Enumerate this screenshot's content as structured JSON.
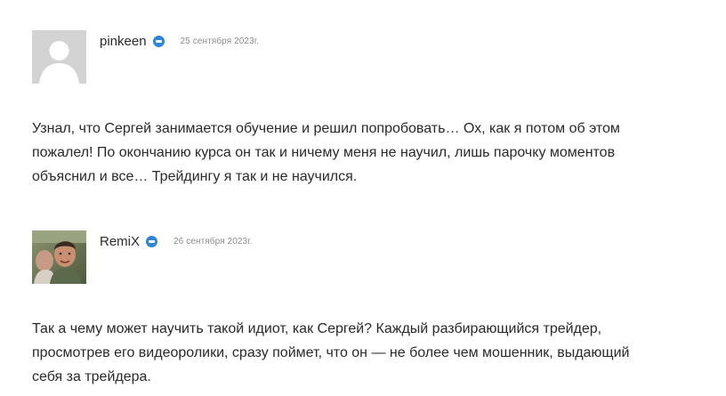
{
  "comments": [
    {
      "author": "pinkeen",
      "date": "25 сентября 2023г.",
      "avatar": "default-avatar-placeholder",
      "verified_icon": "verified-badge-icon",
      "lines": [
        "Узнал, что Сергей занимается обучение и решил попробовать… Ох, как я потом об этом",
        "пожалел! По окончанию курса он так и ничему меня не научил, лишь парочку моментов",
        "объяснил и все… Трейдингу я так и не научился."
      ]
    },
    {
      "author": "RemiX",
      "date": "26 сентября 2023г.",
      "avatar": "user-photo-avatar",
      "verified_icon": "verified-badge-icon",
      "lines": [
        "Так а чему может научить такой идиот, как Сергей? Каждый разбирающийся трейдер,",
        "просмотрев его видеоролики, сразу поймет, что он — не более чем мошенник, выдающий",
        "себя за трейдера."
      ]
    }
  ],
  "colors": {
    "badge": "#2f86d4",
    "text": "#2a2a2a",
    "date": "#8a8a8a",
    "placeholder_avatar": "#d3d3d3"
  }
}
